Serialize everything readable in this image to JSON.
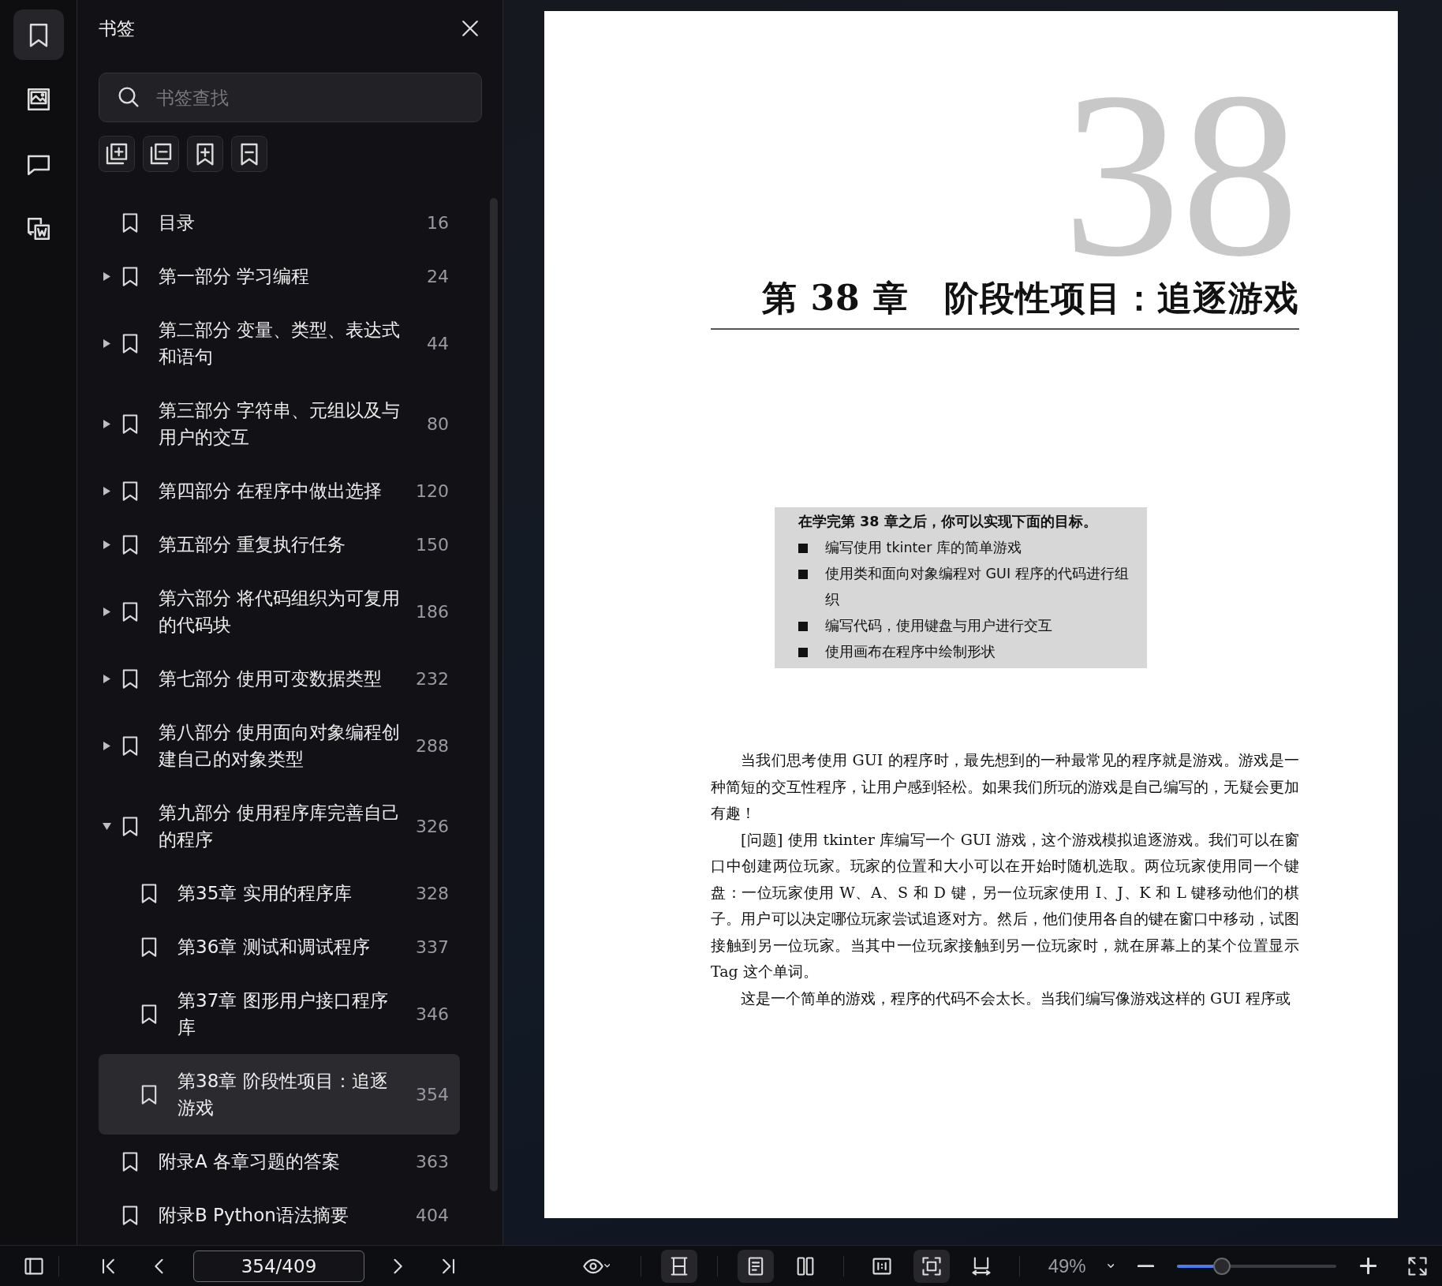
{
  "rail": [
    {
      "kind": "bookmarks",
      "selected": true
    },
    {
      "kind": "images",
      "selected": false
    },
    {
      "kind": "comments",
      "selected": false
    },
    {
      "kind": "convert",
      "selected": false
    }
  ],
  "panel": {
    "title": "书签",
    "search": {
      "placeholder": "书签查找"
    },
    "tools": [
      {
        "kind": "expand-all"
      },
      {
        "kind": "collapse-all"
      },
      {
        "kind": "add"
      },
      {
        "kind": "remove"
      }
    ],
    "bookmarks": [
      {
        "title": "目录",
        "page": "16",
        "selected": false
      },
      {
        "title": "第一部分 学习编程",
        "page": "24",
        "expanded": false,
        "selected": false
      },
      {
        "title": "第二部分 变量、类型、表达式和语句",
        "page": "44",
        "expanded": false,
        "selected": false
      },
      {
        "title": "第三部分 字符串、元组以及与用户的交互",
        "page": "80",
        "expanded": false,
        "selected": false
      },
      {
        "title": "第四部分 在程序中做出选择",
        "page": "120",
        "expanded": false,
        "selected": false
      },
      {
        "title": "第五部分 重复执行任务",
        "page": "150",
        "expanded": false,
        "selected": false
      },
      {
        "title": "第六部分 将代码组织为可复用的代码块",
        "page": "186",
        "expanded": false,
        "selected": false
      },
      {
        "title": "第七部分 使用可变数据类型",
        "page": "232",
        "expanded": false,
        "selected": false
      },
      {
        "title": "第八部分 使用面向对象编程创建自己的对象类型",
        "page": "288",
        "expanded": false,
        "selected": false
      },
      {
        "title": "第九部分 使用程序库完善自己的程序",
        "page": "326",
        "expanded": true,
        "selected": false,
        "children": [
          {
            "title": "第35章 实用的程序库",
            "page": "328",
            "selected": false
          },
          {
            "title": "第36章 测试和调试程序",
            "page": "337",
            "selected": false
          },
          {
            "title": "第37章 图形用户接口程序库",
            "page": "346",
            "selected": false
          },
          {
            "title": "第38章 阶段性项目：追逐游戏",
            "page": "354",
            "selected": true
          }
        ]
      },
      {
        "title": "附录A 各章习题的答案",
        "page": "363",
        "selected": false
      },
      {
        "title": "附录B Python语法摘要",
        "page": "404",
        "selected": false
      }
    ]
  },
  "document": {
    "chapter_numeral": "38",
    "chapter_title": "第 38 章　阶段性项目：追逐游戏",
    "goals": {
      "heading": "在学完第 38 章之后，你可以实现下面的目标。",
      "items": [
        "编写使用 tkinter 库的简单游戏",
        "使用类和面向对象编程对 GUI 程序的代码进行组织",
        "编写代码，使用键盘与用户进行交互",
        "使用画布在程序中绘制形状"
      ]
    },
    "paragraphs": [
      "当我们思考使用 GUI 的程序时，最先想到的一种最常见的程序就是游戏。游戏是一种简短的交互性程序，让用户感到轻松。如果我们所玩的游戏是自己编写的，无疑会更加有趣！",
      "[问题] 使用 tkinter 库编写一个 GUI 游戏，这个游戏模拟追逐游戏。我们可以在窗口中创建两位玩家。玩家的位置和大小可以在开始时随机选取。两位玩家使用同一个键盘：一位玩家使用 W、A、S 和 D 键，另一位玩家使用 I、J、K 和 L 键移动他们的棋子。用户可以决定哪位玩家尝试追逐对方。然后，他们使用各自的键在窗口中移动，试图接触到另一位玩家。当其中一位玩家接触到另一位玩家时，就在屏幕上的某个位置显示 Tag 这个单词。",
      "这是一个简单的游戏，程序的代码不会太长。当我们编写像游戏这样的 GUI 程序或"
    ]
  },
  "toolbar": {
    "page_field": {
      "value": "354/409"
    },
    "view_buttons": [
      {
        "kind": "fit-height",
        "selected": true
      },
      {
        "kind": "single-page",
        "selected": true
      },
      {
        "kind": "two-page",
        "selected": false
      },
      {
        "kind": "actual-size",
        "selected": false
      },
      {
        "kind": "fit-page",
        "selected": true
      },
      {
        "kind": "fit-width",
        "selected": false
      }
    ],
    "zoom": {
      "value": "49%",
      "level": 0.28
    }
  }
}
